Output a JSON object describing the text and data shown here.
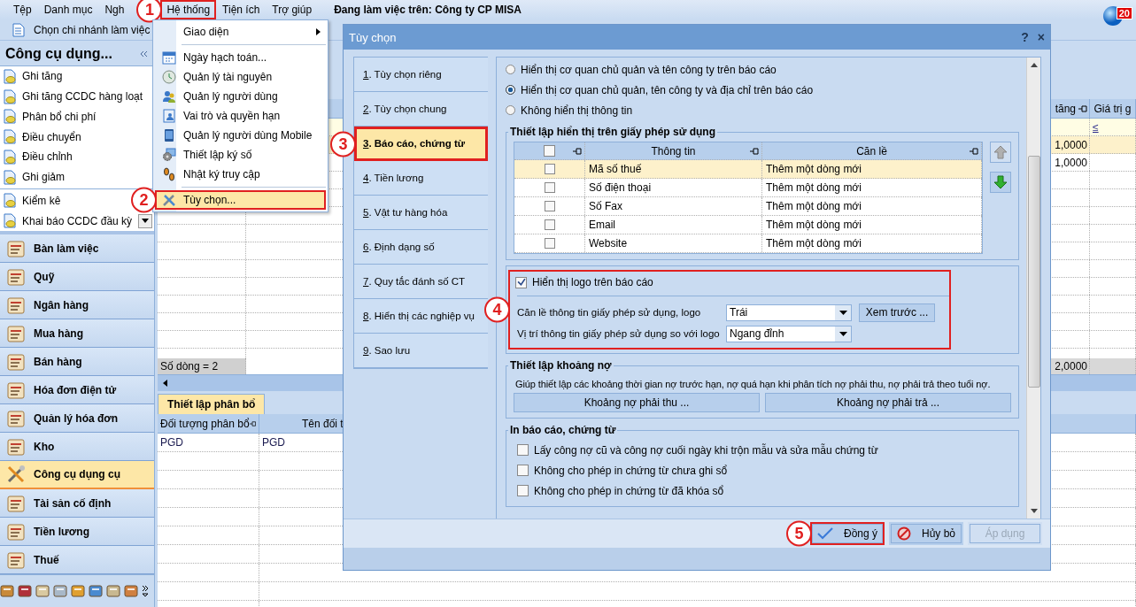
{
  "menubar": {
    "items": [
      {
        "label": "Tệp",
        "highlighted": false
      },
      {
        "label": "Danh mục",
        "highlighted": false
      },
      {
        "label": "Ngh",
        "highlighted": false
      },
      {
        "label": "Hệ thống",
        "highlighted": true,
        "step": "1"
      },
      {
        "label": "Tiện ích",
        "highlighted": false
      },
      {
        "label": "Trợ giúp",
        "highlighted": false
      }
    ],
    "status": "Đang làm việc trên: Công ty CP MISA",
    "notification_count": "20"
  },
  "toolbar": {
    "branch_button": "Chọn chi nhánh làm việc"
  },
  "system_menu": {
    "items": [
      {
        "kind": "submenu",
        "label": "Giao diện",
        "separator_before": false,
        "selected": false,
        "highlighted": false
      },
      {
        "kind": "item",
        "label": "Ngày hạch toán...",
        "separator_before": true,
        "selected": false,
        "highlighted": false
      },
      {
        "kind": "item",
        "label": "Quản lý tài nguyên",
        "separator_before": false,
        "selected": false,
        "highlighted": false
      },
      {
        "kind": "item",
        "label": "Quản lý người dùng",
        "separator_before": false,
        "selected": false,
        "highlighted": false
      },
      {
        "kind": "item",
        "label": "Vai trò và quyền hạn",
        "separator_before": false,
        "selected": false,
        "highlighted": false
      },
      {
        "kind": "item",
        "label": "Quản lý người dùng Mobile",
        "separator_before": false,
        "selected": false,
        "highlighted": false
      },
      {
        "kind": "item",
        "label": "Thiết lập ký số",
        "separator_before": false,
        "selected": false,
        "highlighted": false
      },
      {
        "kind": "item",
        "label": "Nhật ký truy cập",
        "separator_before": false,
        "selected": false,
        "highlighted": false
      },
      {
        "kind": "item",
        "label": "Tùy chọn...",
        "separator_before": true,
        "selected": true,
        "highlighted": true,
        "step": "2"
      }
    ]
  },
  "sidebar": {
    "title": "Công cụ dụng...",
    "items": [
      {
        "label": "Ghi tăng",
        "separator_before": false
      },
      {
        "label": "Ghi tăng CCDC hàng loạt",
        "separator_before": false
      },
      {
        "label": "Phân bổ chi phí",
        "separator_before": false
      },
      {
        "label": "Điều chuyển",
        "separator_before": false
      },
      {
        "label": "Điều chỉnh",
        "separator_before": false
      },
      {
        "label": "Ghi giảm",
        "separator_before": false
      },
      {
        "label": "Kiểm kê",
        "separator_before": true
      },
      {
        "label": "Khai báo CCDC đầu kỳ",
        "separator_before": false
      }
    ],
    "modules": [
      {
        "label": "Bàn làm việc",
        "selected": false
      },
      {
        "label": "Quỹ",
        "selected": false
      },
      {
        "label": "Ngân hàng",
        "selected": false
      },
      {
        "label": "Mua hàng",
        "selected": false
      },
      {
        "label": "Bán hàng",
        "selected": false
      },
      {
        "label": "Hóa đơn điện tử",
        "selected": false
      },
      {
        "label": "Quản lý hóa đơn",
        "selected": false
      },
      {
        "label": "Kho",
        "selected": false
      },
      {
        "label": "Công cụ dụng cụ",
        "selected": true
      },
      {
        "label": "Tài sản cố định",
        "selected": false
      },
      {
        "label": "Tiền lương",
        "selected": false
      },
      {
        "label": "Thuế",
        "selected": false
      }
    ]
  },
  "workspace": {
    "grid": {
      "columns": [
        "tăng",
        "Giá trị g"
      ],
      "filter": "≤",
      "rows": [
        {
          "selected": true,
          "value": "1,0000"
        },
        {
          "selected": false,
          "value": "1,0000"
        }
      ],
      "footer_count": "Số dòng = 2",
      "footer_total": "2,0000"
    },
    "detail": {
      "tab": "Thiết lập phân bổ",
      "columns": [
        "Đối tượng phân bổ",
        "Tên đối t"
      ],
      "rows": [
        [
          "PGD",
          "PGD"
        ]
      ]
    }
  },
  "dialog": {
    "title": "Tùy chọn",
    "help_button": "?",
    "close_button": "×",
    "nav": [
      {
        "hotkey": "1",
        "label": ". Tùy chọn riêng",
        "selected": false,
        "highlighted": false
      },
      {
        "hotkey": "2",
        "label": ". Tùy chọn chung",
        "selected": false,
        "highlighted": false
      },
      {
        "hotkey": "3",
        "label": ". Báo cáo, chứng từ",
        "selected": true,
        "highlighted": true,
        "step": "3"
      },
      {
        "hotkey": "4",
        "label": ". Tiền lương",
        "selected": false,
        "highlighted": false
      },
      {
        "hotkey": "5",
        "label": ". Vật tư hàng hóa",
        "selected": false,
        "highlighted": false
      },
      {
        "hotkey": "6",
        "label": ". Định dạng số",
        "selected": false,
        "highlighted": false
      },
      {
        "hotkey": "7",
        "label": ". Quy tắc đánh số CT",
        "selected": false,
        "highlighted": false
      },
      {
        "hotkey": "8",
        "label": ". Hiển thị các nghiệp vụ",
        "selected": false,
        "highlighted": false
      },
      {
        "hotkey": "9",
        "label": ". Sao lưu",
        "selected": false,
        "highlighted": false
      }
    ],
    "display_options": [
      {
        "label": "Hiển thị cơ quan chủ quản và tên công ty trên báo cáo",
        "selected": false
      },
      {
        "label": "Hiển thị cơ quan chủ quản, tên công ty và địa chỉ trên báo cáo",
        "selected": true
      },
      {
        "label": "Không hiển thị thông tin",
        "selected": false
      }
    ],
    "license": {
      "title": "Thiết lập hiển thị trên giấy phép sử dụng",
      "all_checked": false,
      "columns": [
        "Thông tin",
        "Căn lề"
      ],
      "rows": [
        {
          "checked": false,
          "selected": true,
          "info": "Mã số thuế",
          "align": "Thêm một dòng mới"
        },
        {
          "checked": false,
          "selected": false,
          "info": "Số điện thoại",
          "align": "Thêm một dòng mới"
        },
        {
          "checked": false,
          "selected": false,
          "info": "Số Fax",
          "align": "Thêm một dòng mới"
        },
        {
          "checked": false,
          "selected": false,
          "info": "Email",
          "align": "Thêm một dòng mới"
        },
        {
          "checked": false,
          "selected": false,
          "info": "Website",
          "align": "Thêm một dòng mới"
        }
      ],
      "move_buttons": [
        {
          "kind": "up",
          "disabled": true
        },
        {
          "kind": "down",
          "disabled": false
        }
      ]
    },
    "logo": {
      "label": "Hiển thị logo trên báo cáo",
      "checked": true,
      "highlighted": true,
      "step": "4",
      "fields": [
        {
          "label": "Căn lề thông tin giấy phép sử dụng, logo",
          "value": "Trái"
        },
        {
          "label": "Vị trí thông tin giấy phép sử dụng so với logo",
          "value": "Ngang đỉnh"
        }
      ],
      "preview_button": "Xem trước ..."
    },
    "debt": {
      "title": "Thiết lập khoảng nợ",
      "description": "Giúp thiết lập các khoảng thời gian nợ trước hạn, nợ quá hạn khi phân tích nợ phải thu, nợ phải trả theo tuổi nợ.",
      "buttons": [
        "Khoảng nợ phải thu ...",
        "Khoảng nợ phải trả ..."
      ]
    },
    "print": {
      "title": "In báo cáo, chứng từ",
      "options": [
        {
          "label": "Lấy công nợ cũ và công nợ cuối ngày khi trộn mẫu và sửa mẫu chứng từ",
          "checked": false
        },
        {
          "label": "Không cho phép in chứng từ chưa ghi sổ",
          "checked": false
        },
        {
          "label": "Không cho phép in chứng từ đã khóa sổ",
          "checked": false
        }
      ]
    },
    "buttons": [
      {
        "kind": "ok",
        "label": "Đồng ý",
        "disabled": false,
        "highlighted": true,
        "step": "5"
      },
      {
        "kind": "cancel",
        "label": "Hủy bỏ",
        "disabled": false,
        "highlighted": false
      },
      {
        "kind": "apply",
        "label": "Áp dụng",
        "disabled": true,
        "highlighted": false
      }
    ]
  }
}
